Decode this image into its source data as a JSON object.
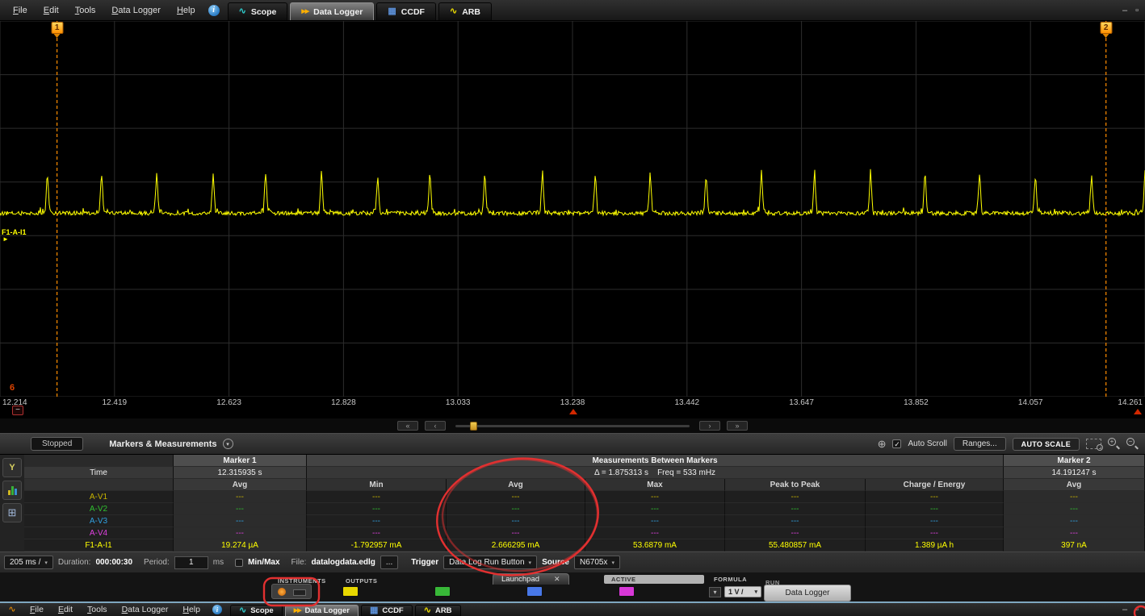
{
  "menubar": {
    "menus": [
      "File",
      "Edit",
      "Tools",
      "Data Logger",
      "Help"
    ],
    "info_icon": "i",
    "tabs": [
      {
        "label": "Scope",
        "icon": "sine",
        "active": false
      },
      {
        "label": "Data Logger",
        "icon": "datalogger",
        "active": true
      },
      {
        "label": "CCDF",
        "icon": "ccdf",
        "active": false
      },
      {
        "label": "ARB",
        "icon": "arb",
        "active": false
      }
    ],
    "window_buttons": [
      "–",
      "▫"
    ]
  },
  "chart": {
    "type": "line",
    "trace_label": "F1-A-I1",
    "x_ticks": [
      "12.214",
      "12.419",
      "12.623",
      "12.828",
      "13.033",
      "13.238",
      "13.442",
      "13.647",
      "13.852",
      "14.057",
      "14.261"
    ],
    "x_range_s": [
      12.214,
      14.261
    ],
    "markers": [
      {
        "id": "1",
        "time_s": 12.315935
      },
      {
        "id": "2",
        "time_s": 14.191247
      }
    ],
    "waveform": {
      "description": "periodic current pulses on noisy near-zero baseline",
      "baseline_mA": 0.4,
      "pulse_peak_mA": 53.7,
      "pulse_period_s": 0.105,
      "noise_mA": 1.5
    },
    "grid": {
      "x_divisions": 10,
      "y_divisions": 7
    }
  },
  "scrollbar": {
    "buttons": [
      "«",
      "‹",
      "›",
      "»"
    ]
  },
  "status_bar": {
    "run_state": "Stopped",
    "view_selector": "Markers & Measurements",
    "auto_scroll": "Auto Scroll",
    "ranges": "Ranges...",
    "auto_scale": "AUTO SCALE"
  },
  "measurements": {
    "marker1_header": "Marker 1",
    "between_header": "Measurements Between Markers",
    "marker2_header": "Marker 2",
    "time_label": "Time",
    "marker1_time": "12.315935 s",
    "delta_text": "Δ = 1.875313 s    Freq = 533 mHz",
    "marker2_time": "14.191247 s",
    "columns": [
      "Avg",
      "Min",
      "Avg",
      "Max",
      "Peak to Peak",
      "Charge / Energy",
      "Avg"
    ],
    "rows": [
      {
        "name": "A-V1",
        "color": "#c8b400",
        "values": [
          "---",
          "---",
          "---",
          "---",
          "---",
          "---",
          "---"
        ]
      },
      {
        "name": "A-V2",
        "color": "#30c030",
        "values": [
          "---",
          "---",
          "---",
          "---",
          "---",
          "---",
          "---"
        ]
      },
      {
        "name": "A-V3",
        "color": "#30a0e0",
        "values": [
          "---",
          "---",
          "---",
          "---",
          "---",
          "---",
          "---"
        ]
      },
      {
        "name": "A-V4",
        "color": "#e040e0",
        "values": [
          "---",
          "---",
          "---",
          "---",
          "---",
          "---",
          "---"
        ]
      },
      {
        "name": "F1-A-I1",
        "color": "#ffff00",
        "values": [
          "19.274 µA",
          "-1.792957 mA",
          "2.666295 mA",
          "53.6879 mA",
          "55.480857 mA",
          "1.389 µA h",
          "397 nA"
        ]
      }
    ]
  },
  "footer": {
    "timebase": "205 ms /",
    "duration_label": "Duration:",
    "duration_value": "000:00:30",
    "period_label": "Period:",
    "period_value": "1",
    "period_unit": "ms",
    "minmax_label": "Min/Max",
    "file_label": "File:",
    "file_value": "datalogdata.edlg",
    "browse": "...",
    "trigger_label": "Trigger",
    "trigger_value": "Data Log Run Button",
    "source_label": "Source",
    "source_value": "N6705x"
  },
  "background_window": {
    "instruments_label": "INSTRUMENTS",
    "outputs_label": "OUTPUTS",
    "launchpad_tab": "Launchpad",
    "close_glyph": "✕",
    "active_label": "ACTIVE",
    "formula_label": "FORMULA",
    "run_label": "RUN",
    "range_value": "1 V /",
    "run_button_label": "Data Logger",
    "output_colors": [
      "#e8d800",
      "#38b838",
      "#4878e8",
      "#d838d8"
    ]
  }
}
